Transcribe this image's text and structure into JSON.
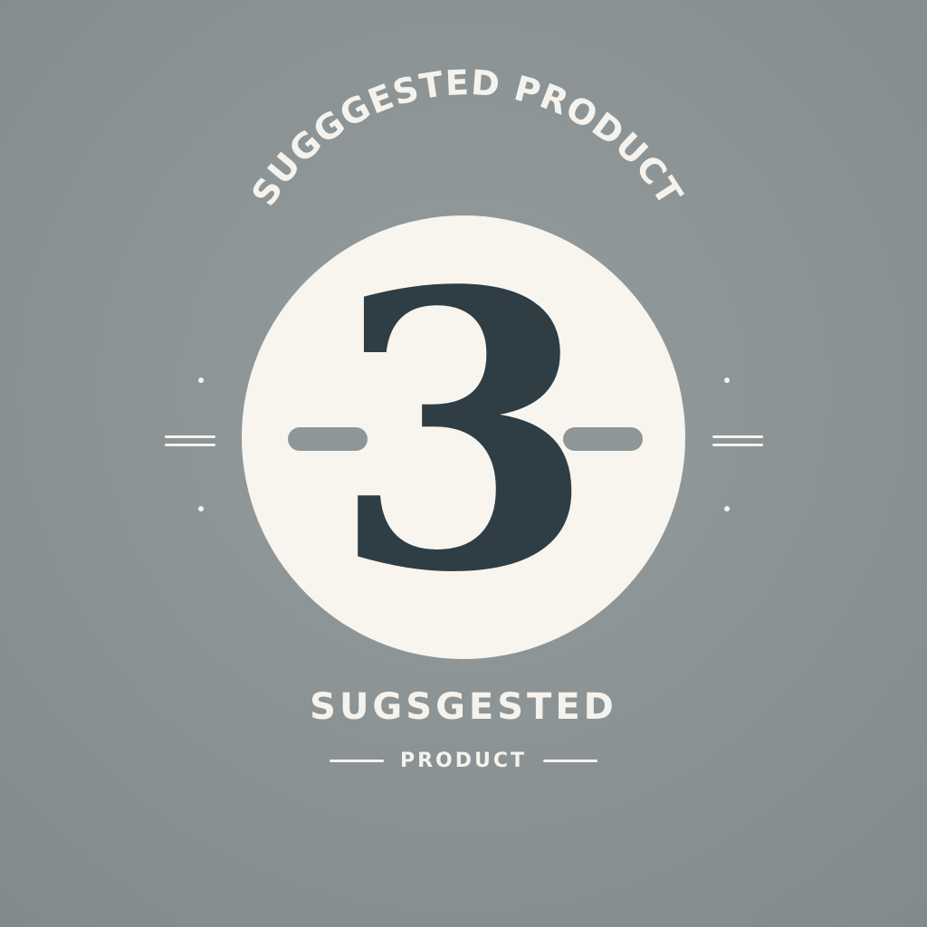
{
  "badge": {
    "arc_text": "SUGGGESTED PRODUCT",
    "number": "3",
    "title": "SUGSGESTED",
    "subtitle": "PRODUCT"
  },
  "colors": {
    "background": "#8c9496",
    "circle": "#f7f5ed",
    "number": "#2f3d45",
    "text": "#f5f3ec",
    "accent_bar": "#8e9698"
  },
  "icons": {
    "left_decoration": "double-line-with-dots-icon",
    "right_decoration": "double-line-with-dots-icon"
  }
}
